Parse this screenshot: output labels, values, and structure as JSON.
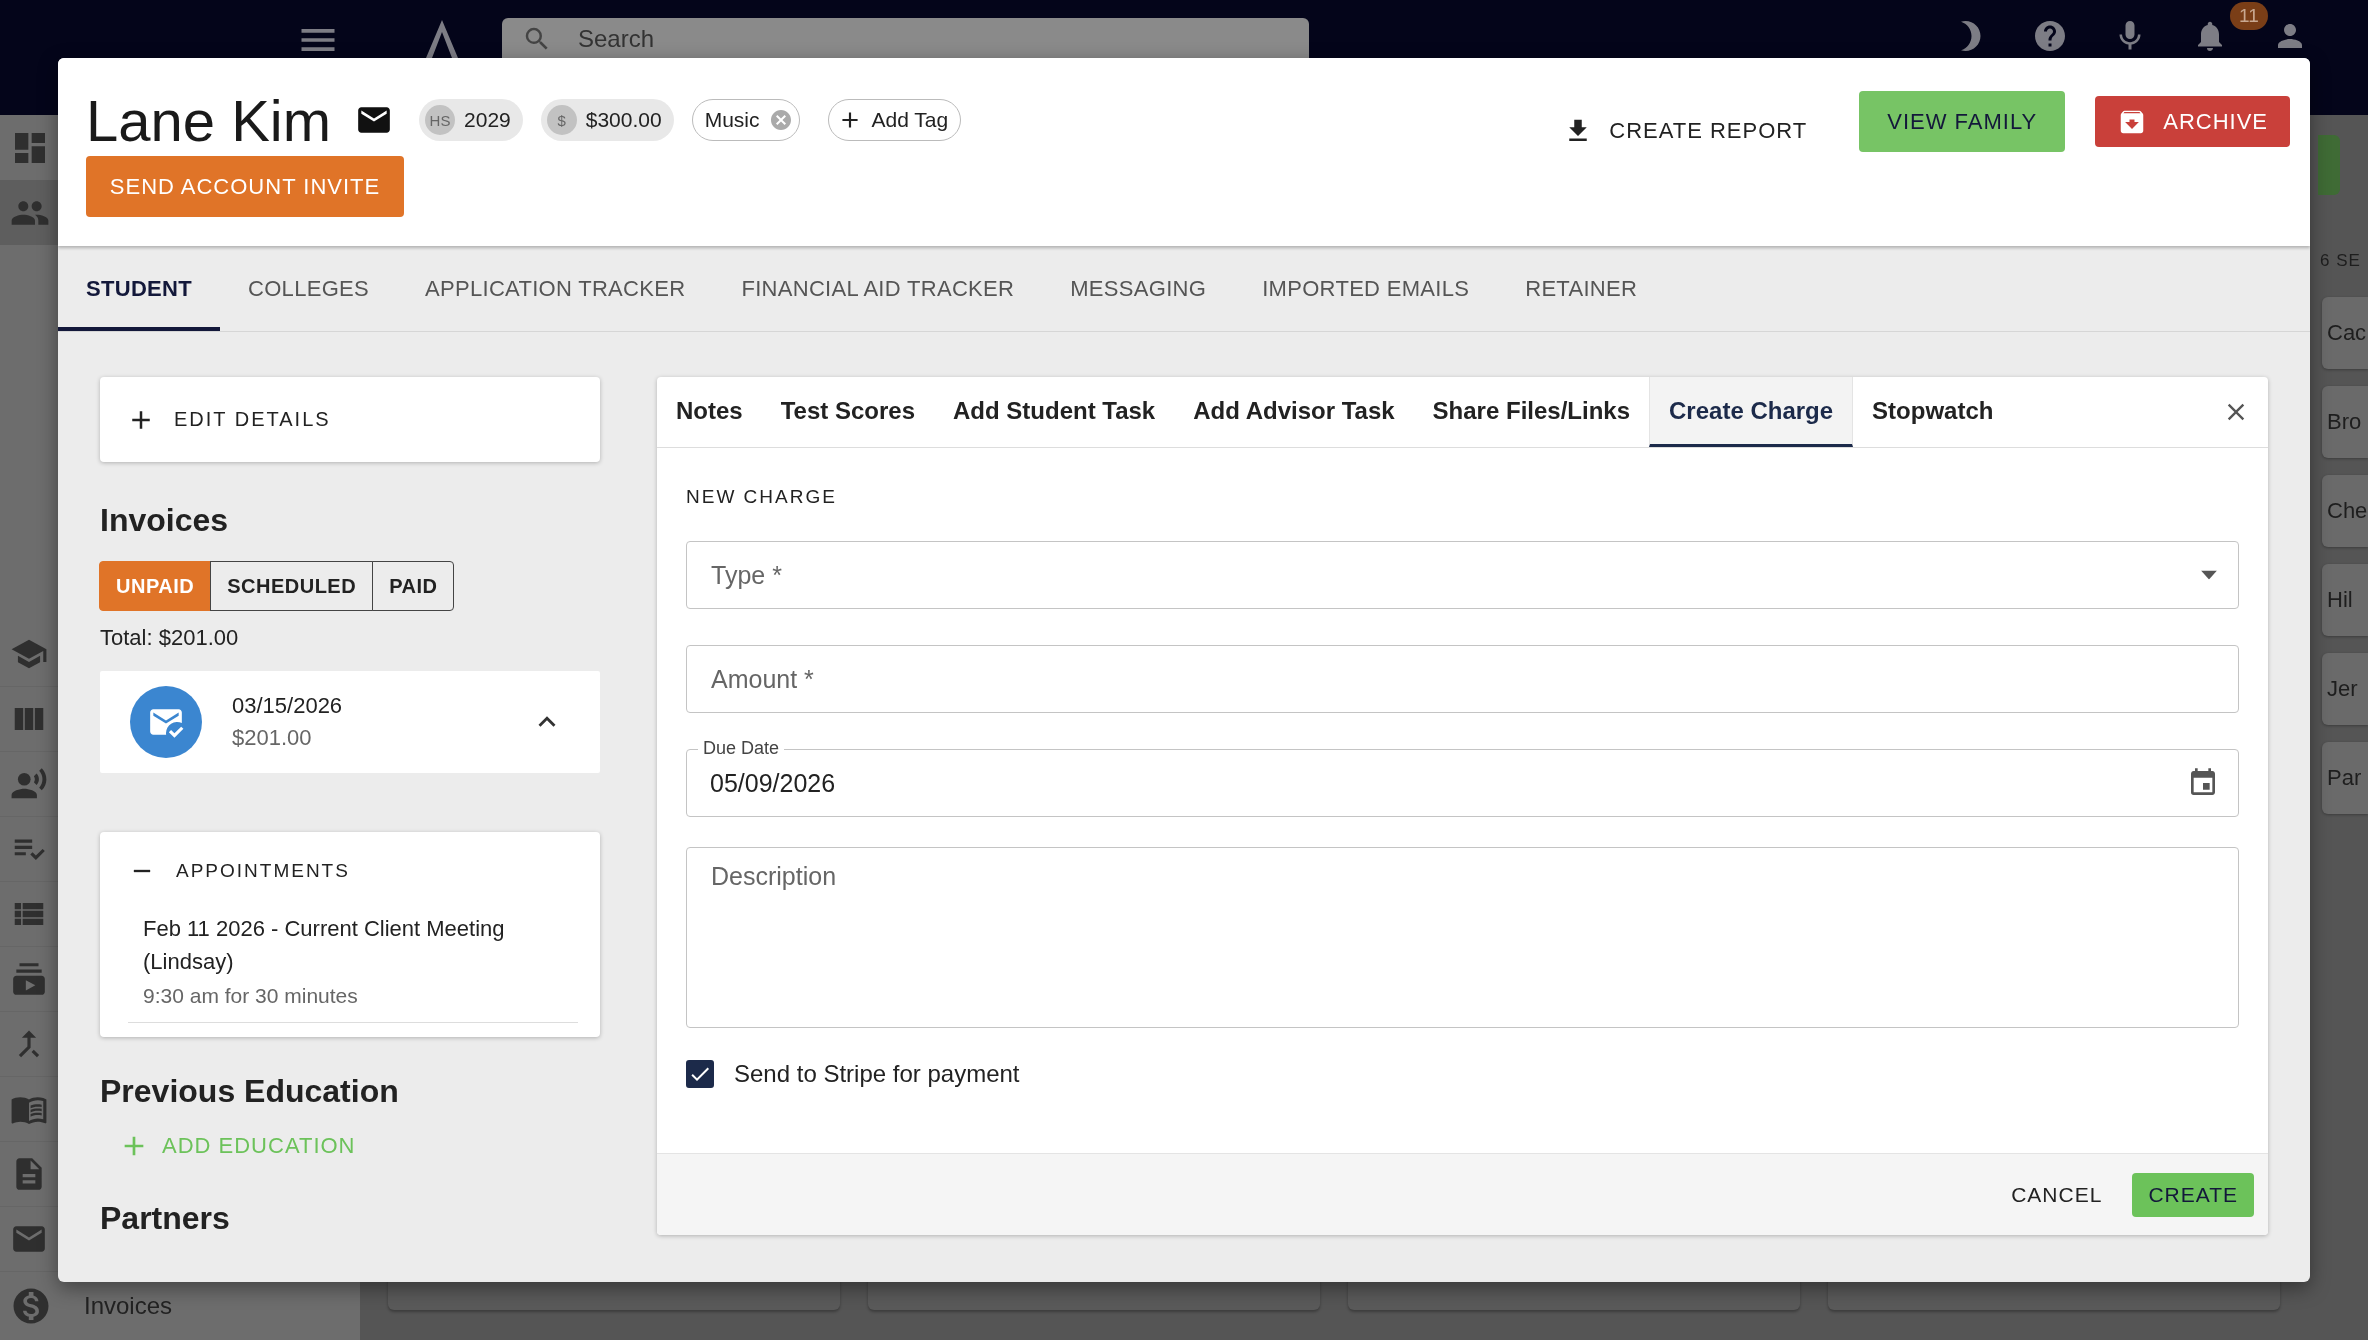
{
  "background": {
    "search": {
      "placeholder": "Search"
    },
    "notification_count": "11",
    "nav_label": "Invoices",
    "side_heading": "6 SE",
    "side_items": [
      "Cac",
      "Bro",
      "Che",
      "Hil",
      "Jer",
      "Par"
    ]
  },
  "student": {
    "name": "Lane Kim",
    "chips": [
      {
        "kind": "avatar",
        "avatar": "HS",
        "label": "2029"
      },
      {
        "kind": "avatar",
        "avatar": "$",
        "label": "$300.00"
      },
      {
        "kind": "tag",
        "label": "Music"
      },
      {
        "kind": "add",
        "label": "Add Tag"
      }
    ],
    "invite_button": "SEND ACCOUNT INVITE",
    "actions": [
      {
        "kind": "report",
        "label": "CREATE REPORT"
      },
      {
        "kind": "family",
        "label": "VIEW FAMILY"
      },
      {
        "kind": "archive",
        "label": "ARCHIVE"
      }
    ]
  },
  "tabs": [
    {
      "label": "STUDENT",
      "selected": true
    },
    {
      "label": "COLLEGES",
      "selected": false
    },
    {
      "label": "APPLICATION TRACKER",
      "selected": false
    },
    {
      "label": "FINANCIAL AID TRACKER",
      "selected": false
    },
    {
      "label": "MESSAGING",
      "selected": false
    },
    {
      "label": "IMPORTED EMAILS",
      "selected": false
    },
    {
      "label": "RETAINER",
      "selected": false
    }
  ],
  "edit_details": "EDIT DETAILS",
  "invoices": {
    "title": "Invoices",
    "filters": [
      {
        "label": "UNPAID",
        "selected": true
      },
      {
        "label": "SCHEDULED",
        "selected": false
      },
      {
        "label": "PAID",
        "selected": false
      }
    ],
    "total": "Total: $201.00",
    "items": [
      {
        "date": "03/15/2026",
        "amount": "$201.00",
        "expanded": true
      }
    ]
  },
  "appointments": {
    "title": "APPOINTMENTS",
    "expanded": true,
    "items": [
      {
        "title": "Feb 11 2026 - Current Client Meeting (Lindsay)",
        "detail": "9:30 am for 30 minutes"
      }
    ]
  },
  "previous_education": {
    "title": "Previous Education",
    "add_label": "ADD EDUCATION"
  },
  "partners": {
    "title": "Partners"
  },
  "panel": {
    "tabs": [
      {
        "label": "Notes",
        "selected": false
      },
      {
        "label": "Test Scores",
        "selected": false
      },
      {
        "label": "Add Student Task",
        "selected": false
      },
      {
        "label": "Add Advisor Task",
        "selected": false
      },
      {
        "label": "Share Files/Links",
        "selected": false
      },
      {
        "label": "Create Charge",
        "selected": true
      },
      {
        "label": "Stopwatch",
        "selected": false
      }
    ],
    "section_title": "NEW CHARGE",
    "fields": [
      {
        "kind": "select",
        "placeholder": "Type *"
      },
      {
        "kind": "text",
        "placeholder": "Amount *"
      },
      {
        "kind": "date",
        "label": "Due Date",
        "value": "05/09/2026"
      },
      {
        "kind": "textarea",
        "placeholder": "Description"
      }
    ],
    "stripe": {
      "label": "Send to Stripe for payment",
      "checked": true
    },
    "cancel": "CANCEL",
    "create": "CREATE"
  }
}
